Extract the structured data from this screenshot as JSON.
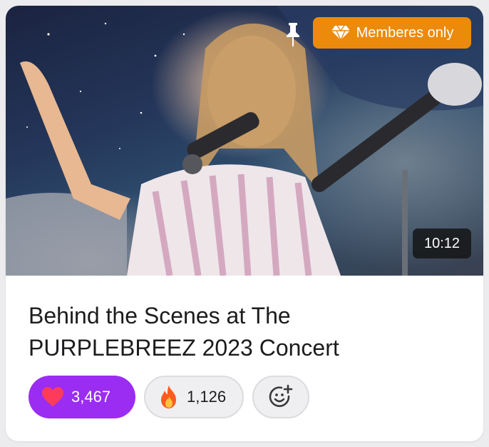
{
  "card": {
    "badge_label": "Memberes only",
    "duration": "10:12",
    "title_line1": "Behind the Scenes at The",
    "title_line2": "PURPLEBREEZ 2023 Concert"
  },
  "reactions": [
    {
      "icon": "heart-icon",
      "count": "3,467",
      "active": true
    },
    {
      "icon": "fire-icon",
      "count": "1,126",
      "active": false
    },
    {
      "icon": "add-reaction-icon"
    }
  ],
  "colors": {
    "badge": "#ec8a0b",
    "active_reaction": "#9b2cf2",
    "heart": "#ff3b5c",
    "fire": "#ff5a1f"
  }
}
